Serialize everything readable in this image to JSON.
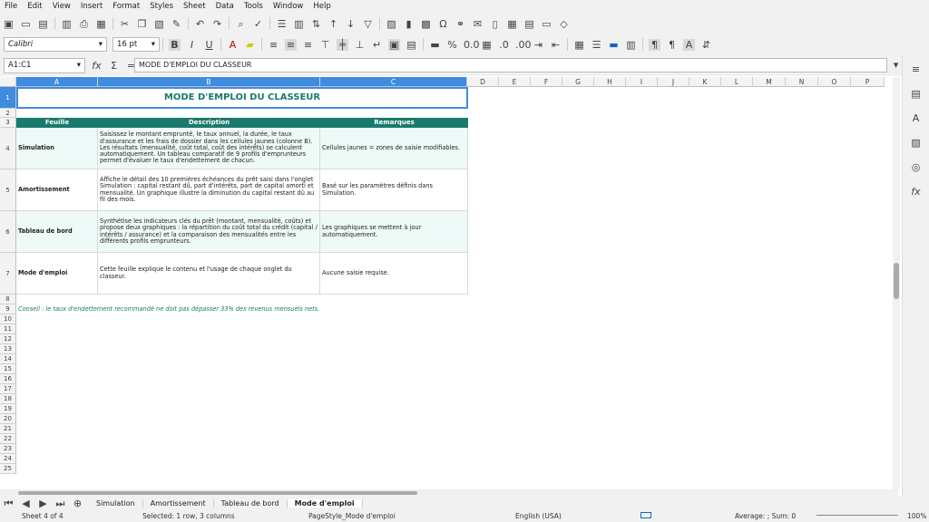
{
  "menu": [
    "File",
    "Edit",
    "View",
    "Insert",
    "Format",
    "Styles",
    "Sheet",
    "Data",
    "Tools",
    "Window",
    "Help"
  ],
  "font_name": "Calibri",
  "font_size": "16 pt",
  "name_box": "A1:C1",
  "formula_content": "MODE D'EMPLOI DU CLASSEUR",
  "columns": [
    "A",
    "B",
    "C",
    "D",
    "E",
    "F",
    "G",
    "H",
    "I",
    "J",
    "K",
    "L",
    "M",
    "N",
    "O",
    "P"
  ],
  "rows": [
    "1",
    "2",
    "3",
    "4",
    "5",
    "6",
    "7",
    "8",
    "9",
    "10",
    "11",
    "12",
    "13",
    "14",
    "15",
    "16",
    "17",
    "18",
    "19",
    "20",
    "21",
    "22",
    "23",
    "24",
    "25"
  ],
  "title": "MODE D'EMPLOI DU CLASSEUR",
  "headers": {
    "a": "Feuille",
    "b": "Description",
    "c": "Remarques"
  },
  "table_rows": [
    {
      "sheet": "Simulation",
      "desc": "Saisissez le montant emprunté, le taux annuel, la durée, le taux d'assurance et les frais de dossier dans les cellules jaunes (colonne B). Les résultats (mensualité, coût total, coût des intérêts) se calculent automatiquement. Un tableau comparatif de 9 profils d'emprunteurs permet d'évaluer le taux d'endettement de chacun.",
      "note": "Cellules jaunes = zones de saisie modifiables."
    },
    {
      "sheet": "Amortissement",
      "desc": "Affiche le détail des 10 premières échéances du prêt saisi dans l'onglet Simulation : capital restant dû, part d'intérêts, part de capital amorti et mensualité. Un graphique illustre la diminution du capital restant dû au fil des mois.",
      "note": "Basé sur les paramètres définis dans Simulation."
    },
    {
      "sheet": "Tableau de bord",
      "desc": "Synthétise les indicateurs clés du prêt (montant, mensualité, coûts) et propose deux graphiques : la répartition du coût total du crédit (capital / intérêts / assurance) et la comparaison des mensualités entre les différents profils emprunteurs.",
      "note": "Les graphiques se mettent à jour automatiquement."
    },
    {
      "sheet": "Mode d'emploi",
      "desc": "Cette feuille explique le contenu et l'usage de chaque onglet du classeur.",
      "note": "Aucune saisie requise."
    }
  ],
  "conseil": "Conseil : le taux d'endettement recommandé ne doit pas dépasser 33% des revenus mensuels nets.",
  "sheet_tabs": [
    "Simulation",
    "Amortissement",
    "Tableau de bord",
    "Mode d'emploi"
  ],
  "active_tab": "Mode d'emploi",
  "status": {
    "sheet": "Sheet 4 of 4",
    "selected": "Selected: 1 row, 3 columns",
    "page_style": "PageStyle_Mode d'emploi",
    "lang": "English (USA)",
    "stats": "Average: ; Sum: 0",
    "zoom": "100%"
  }
}
